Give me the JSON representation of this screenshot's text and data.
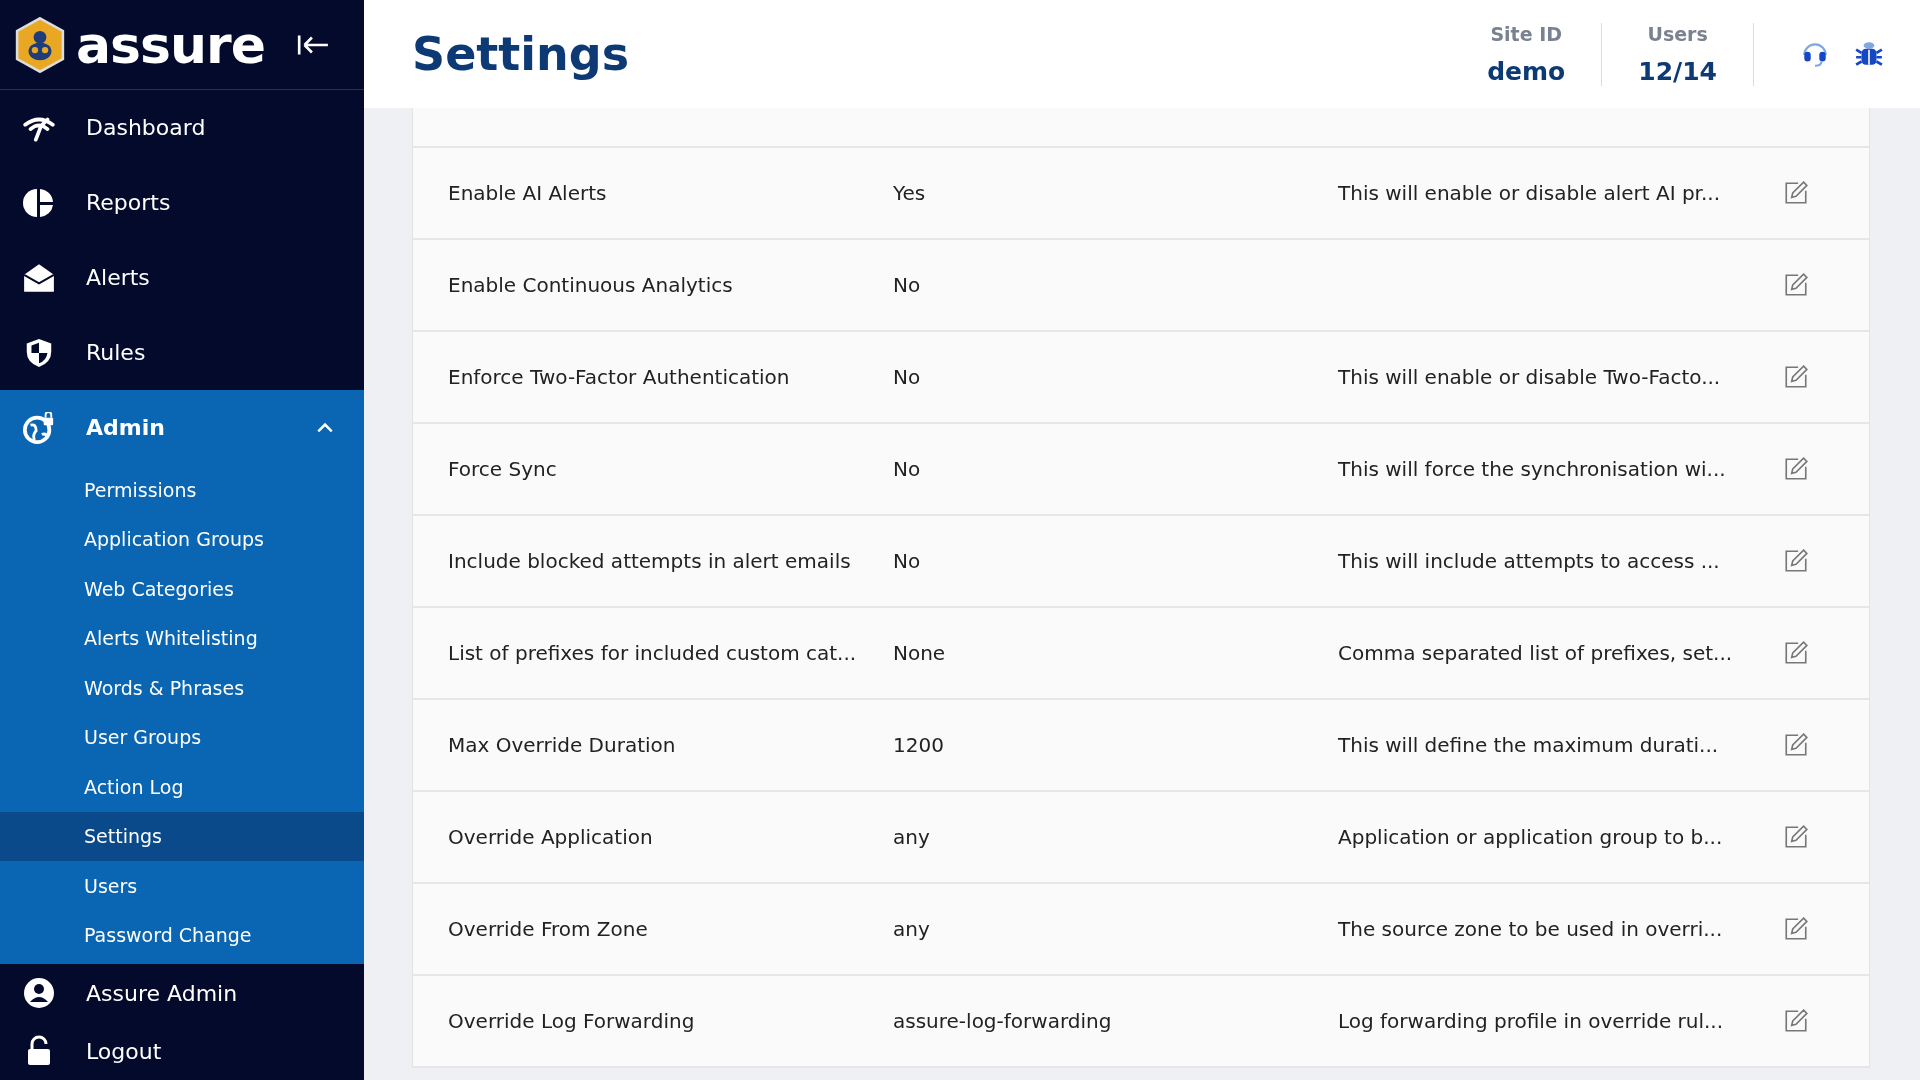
{
  "brand": {
    "name": "assure"
  },
  "header": {
    "title": "Settings",
    "stats": [
      {
        "label": "Site ID",
        "value": "demo"
      },
      {
        "label": "Users",
        "value": "12/14"
      }
    ]
  },
  "sidebar": {
    "items": [
      {
        "label": "Dashboard",
        "selected": false
      },
      {
        "label": "Reports",
        "selected": false
      },
      {
        "label": "Alerts",
        "selected": false
      },
      {
        "label": "Rules",
        "selected": false
      },
      {
        "label": "Admin",
        "selected": true,
        "expanded": true,
        "children": [
          {
            "label": "Permissions",
            "selected": false
          },
          {
            "label": "Application Groups",
            "selected": false
          },
          {
            "label": "Web Categories",
            "selected": false
          },
          {
            "label": "Alerts Whitelisting",
            "selected": false
          },
          {
            "label": "Words & Phrases",
            "selected": false
          },
          {
            "label": "User Groups",
            "selected": false
          },
          {
            "label": "Action Log",
            "selected": false
          },
          {
            "label": "Settings",
            "selected": true
          },
          {
            "label": "Users",
            "selected": false
          },
          {
            "label": "Password Change",
            "selected": false
          }
        ]
      }
    ],
    "footer_items": [
      {
        "label": "Assure Admin"
      },
      {
        "label": "Logout"
      }
    ]
  },
  "table": {
    "rows": [
      {
        "name": "Enable AI Alerts",
        "value": "Yes",
        "description": "This will enable or disable alert AI pr..."
      },
      {
        "name": "Enable Continuous Analytics",
        "value": "No",
        "description": ""
      },
      {
        "name": "Enforce Two-Factor Authentication",
        "value": "No",
        "description": "This will enable or disable Two-Facto..."
      },
      {
        "name": "Force Sync",
        "value": "No",
        "description": "This will force the synchronisation wi..."
      },
      {
        "name": "Include blocked attempts in alert emails",
        "value": "No",
        "description": "This will include attempts to access ..."
      },
      {
        "name": "List of prefixes for included custom cat...",
        "value": "None",
        "description": "Comma separated list of prefixes, set..."
      },
      {
        "name": "Max Override Duration",
        "value": "1200",
        "description": "This will define the maximum durati..."
      },
      {
        "name": "Override Application",
        "value": "any",
        "description": "Application or application group to b..."
      },
      {
        "name": "Override From Zone",
        "value": "any",
        "description": "The source zone to be used in overri..."
      },
      {
        "name": "Override Log Forwarding",
        "value": "assure-log-forwarding",
        "description": "Log forwarding profile in override rul..."
      }
    ]
  }
}
